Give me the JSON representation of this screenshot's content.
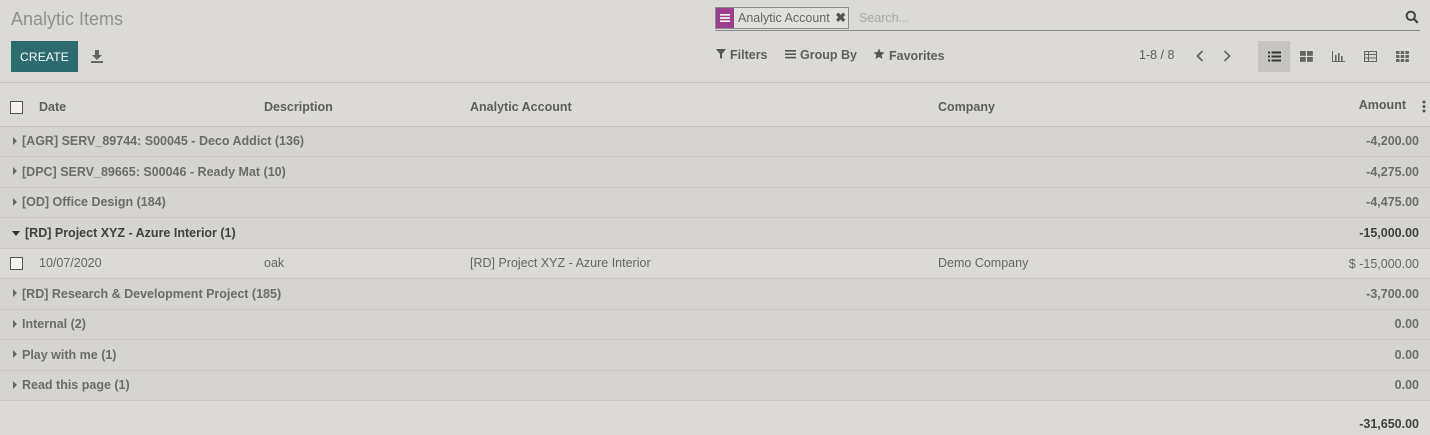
{
  "page_title": "Analytic Items",
  "toolbar": {
    "create_label": "CREATE"
  },
  "search": {
    "facet_label": "Analytic Account",
    "placeholder": "Search..."
  },
  "filters": {
    "filters_label": "Filters",
    "groupby_label": "Group By",
    "favorites_label": "Favorites"
  },
  "pager": {
    "text": "1-8 / 8"
  },
  "views": [
    "list",
    "kanban",
    "graph",
    "pivot",
    "grid"
  ],
  "active_view": "list",
  "colors": {
    "primary": "#2c6b6e",
    "facet": "#9c3f8c"
  },
  "table": {
    "headers": {
      "date": "Date",
      "description": "Description",
      "account": "Analytic Account",
      "company": "Company",
      "amount": "Amount"
    },
    "groups": [
      {
        "label": "[AGR] SERV_89744: S00045 - Deco Addict (136)",
        "total": "-4,200.00",
        "open": false
      },
      {
        "label": "[DPC] SERV_89665: S00046 - Ready Mat (10)",
        "total": "-4,275.00",
        "open": false
      },
      {
        "label": "[OD] Office Design (184)",
        "total": "-4,475.00",
        "open": false
      },
      {
        "label": "[RD] Project XYZ - Azure Interior (1)",
        "total": "-15,000.00",
        "open": true
      },
      {
        "label": "[RD] Research & Development Project (185)",
        "total": "-3,700.00",
        "open": false
      },
      {
        "label": "Internal (2)",
        "total": "0.00",
        "open": false
      },
      {
        "label": "Play with me (1)",
        "total": "0.00",
        "open": false
      },
      {
        "label": "Read this page (1)",
        "total": "0.00",
        "open": false
      }
    ],
    "open_row": {
      "date": "10/07/2020",
      "description": "oak",
      "account": "[RD] Project XYZ - Azure Interior",
      "company": "Demo Company",
      "amount": "$ -15,000.00"
    },
    "grand_total": "-31,650.00"
  }
}
